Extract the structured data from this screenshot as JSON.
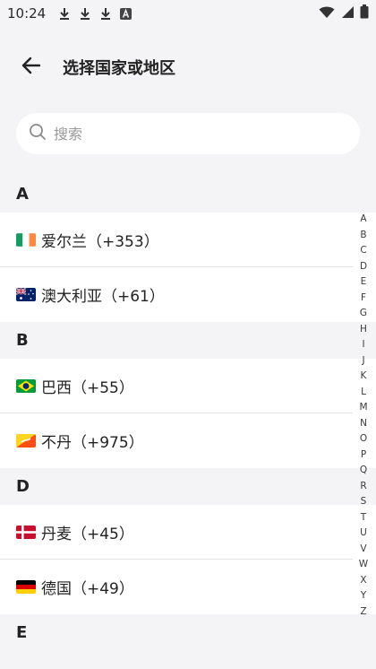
{
  "status_bar": {
    "time": "10:24",
    "left_icons": [
      "download-icon",
      "download-icon",
      "download-icon",
      "a-badge-icon"
    ],
    "right_icons": [
      "wifi-icon",
      "signal-icon",
      "battery-icon"
    ]
  },
  "header": {
    "title": "选择国家或地区",
    "back_icon": "back-arrow-icon"
  },
  "search": {
    "placeholder": "搜索",
    "icon": "search-icon"
  },
  "sections": [
    {
      "letter": "A",
      "countries": [
        {
          "name": "爱尔兰（+353）",
          "flag": "ireland-flag-icon"
        },
        {
          "name": "澳大利亚（+61）",
          "flag": "australia-flag-icon"
        }
      ]
    },
    {
      "letter": "B",
      "countries": [
        {
          "name": "巴西（+55）",
          "flag": "brazil-flag-icon"
        },
        {
          "name": "不丹（+975）",
          "flag": "bhutan-flag-icon"
        }
      ]
    },
    {
      "letter": "D",
      "countries": [
        {
          "name": "丹麦（+45）",
          "flag": "denmark-flag-icon"
        },
        {
          "name": "德国（+49）",
          "flag": "germany-flag-icon"
        }
      ]
    },
    {
      "letter": "E",
      "countries": []
    }
  ],
  "alphabet_index": [
    "A",
    "B",
    "C",
    "D",
    "E",
    "F",
    "G",
    "H",
    "I",
    "J",
    "K",
    "L",
    "M",
    "N",
    "O",
    "P",
    "Q",
    "R",
    "S",
    "T",
    "U",
    "V",
    "W",
    "X",
    "Y",
    "Z"
  ],
  "colors": {
    "background": "#f4f4f6",
    "row_background": "#ffffff",
    "divider": "#e3e3e3",
    "text": "#222222",
    "placeholder": "#9a9a9a"
  }
}
